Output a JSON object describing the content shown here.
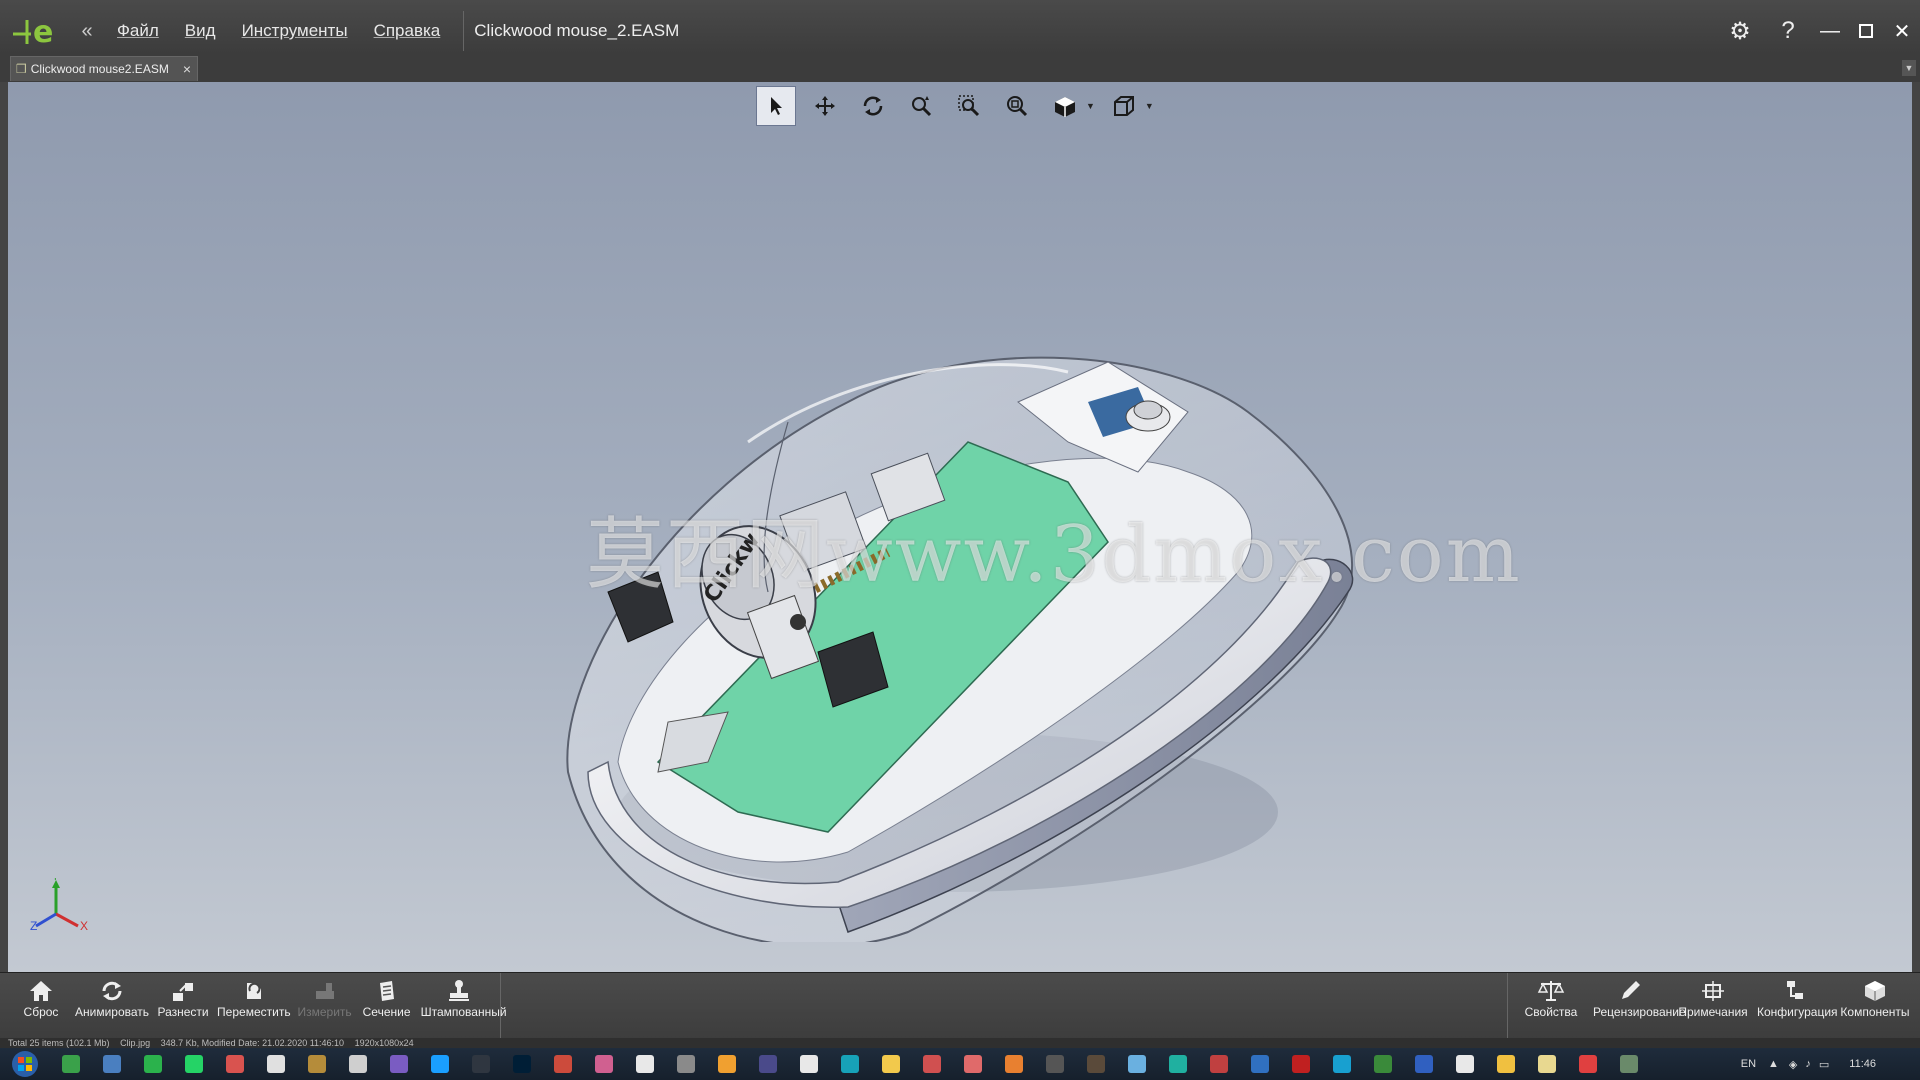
{
  "app": {
    "menu": [
      "Файл",
      "Вид",
      "Инструменты",
      "Справка"
    ],
    "document_title": "Clickwood mouse_2.EASM",
    "tab_label": "Clickwood mouse2.EASM"
  },
  "watermark": "莫西网www.3dmox.com",
  "axis_labels": {
    "x": "X",
    "y": "Y",
    "z": "Z"
  },
  "view_toolbar": [
    {
      "name": "select",
      "icon": "cursor-icon"
    },
    {
      "name": "pan",
      "icon": "move-icon"
    },
    {
      "name": "rotate",
      "icon": "rotate-icon"
    },
    {
      "name": "zoom",
      "icon": "zoom-icon"
    },
    {
      "name": "zoom-window",
      "icon": "zoom-area-icon"
    },
    {
      "name": "zoom-fit",
      "icon": "zoom-fit-icon"
    },
    {
      "name": "display-mode",
      "icon": "display-style-icon"
    },
    {
      "name": "view-orientation",
      "icon": "cube-view-icon"
    }
  ],
  "ribbon_left": [
    {
      "label": "Сброс",
      "icon": "home-icon"
    },
    {
      "label": "Анимировать",
      "icon": "animate-icon"
    },
    {
      "label": "Разнести",
      "icon": "explode-icon"
    },
    {
      "label": "Переместить",
      "icon": "move-part-icon"
    },
    {
      "label": "Измерить",
      "icon": "measure-icon",
      "disabled": true
    },
    {
      "label": "Сечение",
      "icon": "section-icon"
    },
    {
      "label": "Штампованный",
      "icon": "stamp-icon"
    }
  ],
  "ribbon_right": [
    {
      "label": "Свойства",
      "icon": "scales-icon"
    },
    {
      "label": "Рецензирование",
      "icon": "pencil-icon"
    },
    {
      "label": "Примечания",
      "icon": "annotation-icon"
    },
    {
      "label": "Конфигурация",
      "icon": "config-icon"
    },
    {
      "label": "Компоненты",
      "icon": "components-icon"
    }
  ],
  "statusline": [
    "Total 25 items (102.1 Mb)",
    "Clip.jpg",
    "348.7 Kb, Modified Date: 21.02.2020 11:46:10",
    "1920x1080x24"
  ],
  "taskbar": {
    "language": "EN",
    "time": "11:46",
    "app_colors": [
      "#3aa14a",
      "#4a7fc0",
      "#2bb24c",
      "#25d366",
      "#d9534f",
      "#e0e0e0",
      "#b58c3a",
      "#cfcfcf",
      "#7a5cc2",
      "#1a9fff",
      "#2f3640",
      "#001e36",
      "#cc4b3c",
      "#d06090",
      "#e8e8e8",
      "#8a8a8a",
      "#f0a030",
      "#4a4a8a",
      "#e8e8e8",
      "#17a2b8",
      "#f2c94c",
      "#d05050",
      "#e06a6a",
      "#e88030",
      "#555555",
      "#5a4a3a",
      "#6ab0e0",
      "#20b0a0",
      "#c04040",
      "#3070c0",
      "#c02020",
      "#18a0d0",
      "#3a8a3a",
      "#3060c0",
      "#e8e8e8",
      "#f0c040",
      "#e8d890",
      "#e04040",
      "#6a8a6a"
    ]
  }
}
